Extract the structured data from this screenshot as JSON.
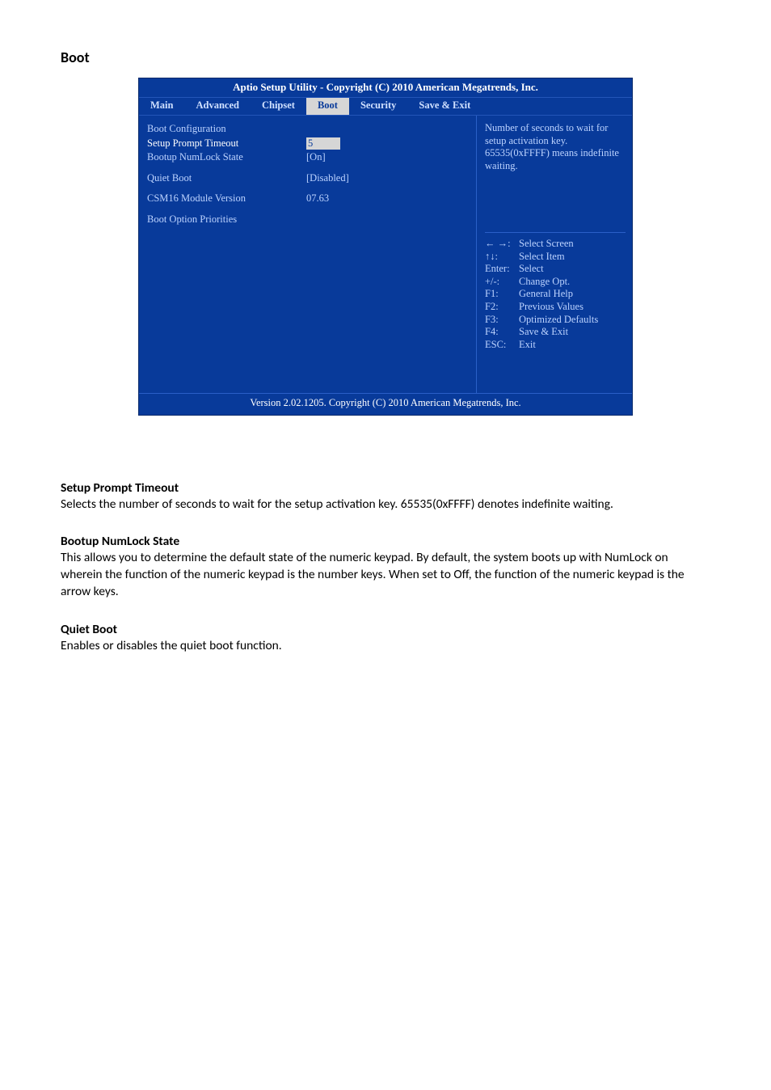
{
  "page": {
    "heading": "Boot"
  },
  "bios": {
    "title": "Aptio Setup Utility - Copyright (C) 2010 American Megatrends, Inc.",
    "tabs": {
      "main": "Main",
      "advanced": "Advanced",
      "chipset": "Chipset",
      "boot": "Boot",
      "security": "Security",
      "save_exit": "Save & Exit"
    },
    "left": {
      "boot_configuration": "Boot Configuration",
      "setup_prompt_timeout": {
        "label": "Setup Prompt Timeout",
        "value": "5"
      },
      "bootup_numlock_state": {
        "label": "Bootup NumLock State",
        "value": "[On]"
      },
      "quiet_boot": {
        "label": "Quiet Boot",
        "value": "[Disabled]"
      },
      "csm16_module_version": {
        "label": "CSM16 Module Version",
        "value": "07.63"
      },
      "boot_option_priorities": "Boot Option Priorities"
    },
    "help": "Number of seconds to wait for setup activation key.\n65535(0xFFFF) means indefinite waiting.",
    "nav": {
      "arrows_h": {
        "key": "← →:",
        "desc": "Select Screen"
      },
      "arrows_v": {
        "key": "↑↓:",
        "desc": "Select Item"
      },
      "enter": {
        "key": "Enter:",
        "desc": "Select"
      },
      "pm": {
        "key": "+/-:",
        "desc": "Change Opt."
      },
      "f1": {
        "key": "F1:",
        "desc": "General Help"
      },
      "f2": {
        "key": "F2:",
        "desc": "Previous Values"
      },
      "f3": {
        "key": "F3:",
        "desc": "Optimized Defaults"
      },
      "f4": {
        "key": "F4:",
        "desc": "Save & Exit"
      },
      "esc": {
        "key": "ESC:",
        "desc": "Exit"
      }
    },
    "footer": "Version 2.02.1205. Copyright (C) 2010 American Megatrends, Inc."
  },
  "descriptions": {
    "setup_prompt_timeout": {
      "heading": "Setup Prompt Timeout",
      "text": "Selects the number of seconds to wait for the setup activation key.  65535(0xFFFF) denotes indefinite waiting."
    },
    "bootup_numlock_state": {
      "heading": "Bootup NumLock State",
      "text": "This allows you to determine the default state of the numeric keypad. By default, the system boots up with NumLock on wherein the function of the numeric keypad is the number keys. When set to Off, the function of the numeric keypad is the arrow keys."
    },
    "quiet_boot": {
      "heading": "Quiet Boot",
      "text": "Enables or disables the quiet boot function."
    }
  }
}
